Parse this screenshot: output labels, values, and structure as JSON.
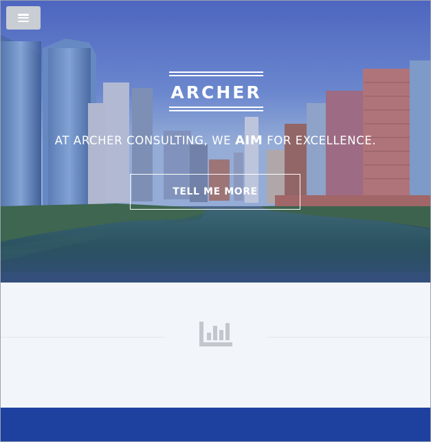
{
  "nav": {
    "menu_icon": "hamburger-menu-icon"
  },
  "hero": {
    "brand": "ARCHER",
    "tagline_pre": "AT ARCHER CONSULTING, WE ",
    "tagline_emphasis": "AIM",
    "tagline_post": " FOR EXCELLENCE.",
    "cta_label": "TELL ME MORE"
  },
  "section": {
    "icon": "bar-chart-icon"
  },
  "colors": {
    "accent_band": "#1e41a0",
    "section_bg": "#f2f5fa",
    "icon_gray": "#c3c6cc"
  }
}
